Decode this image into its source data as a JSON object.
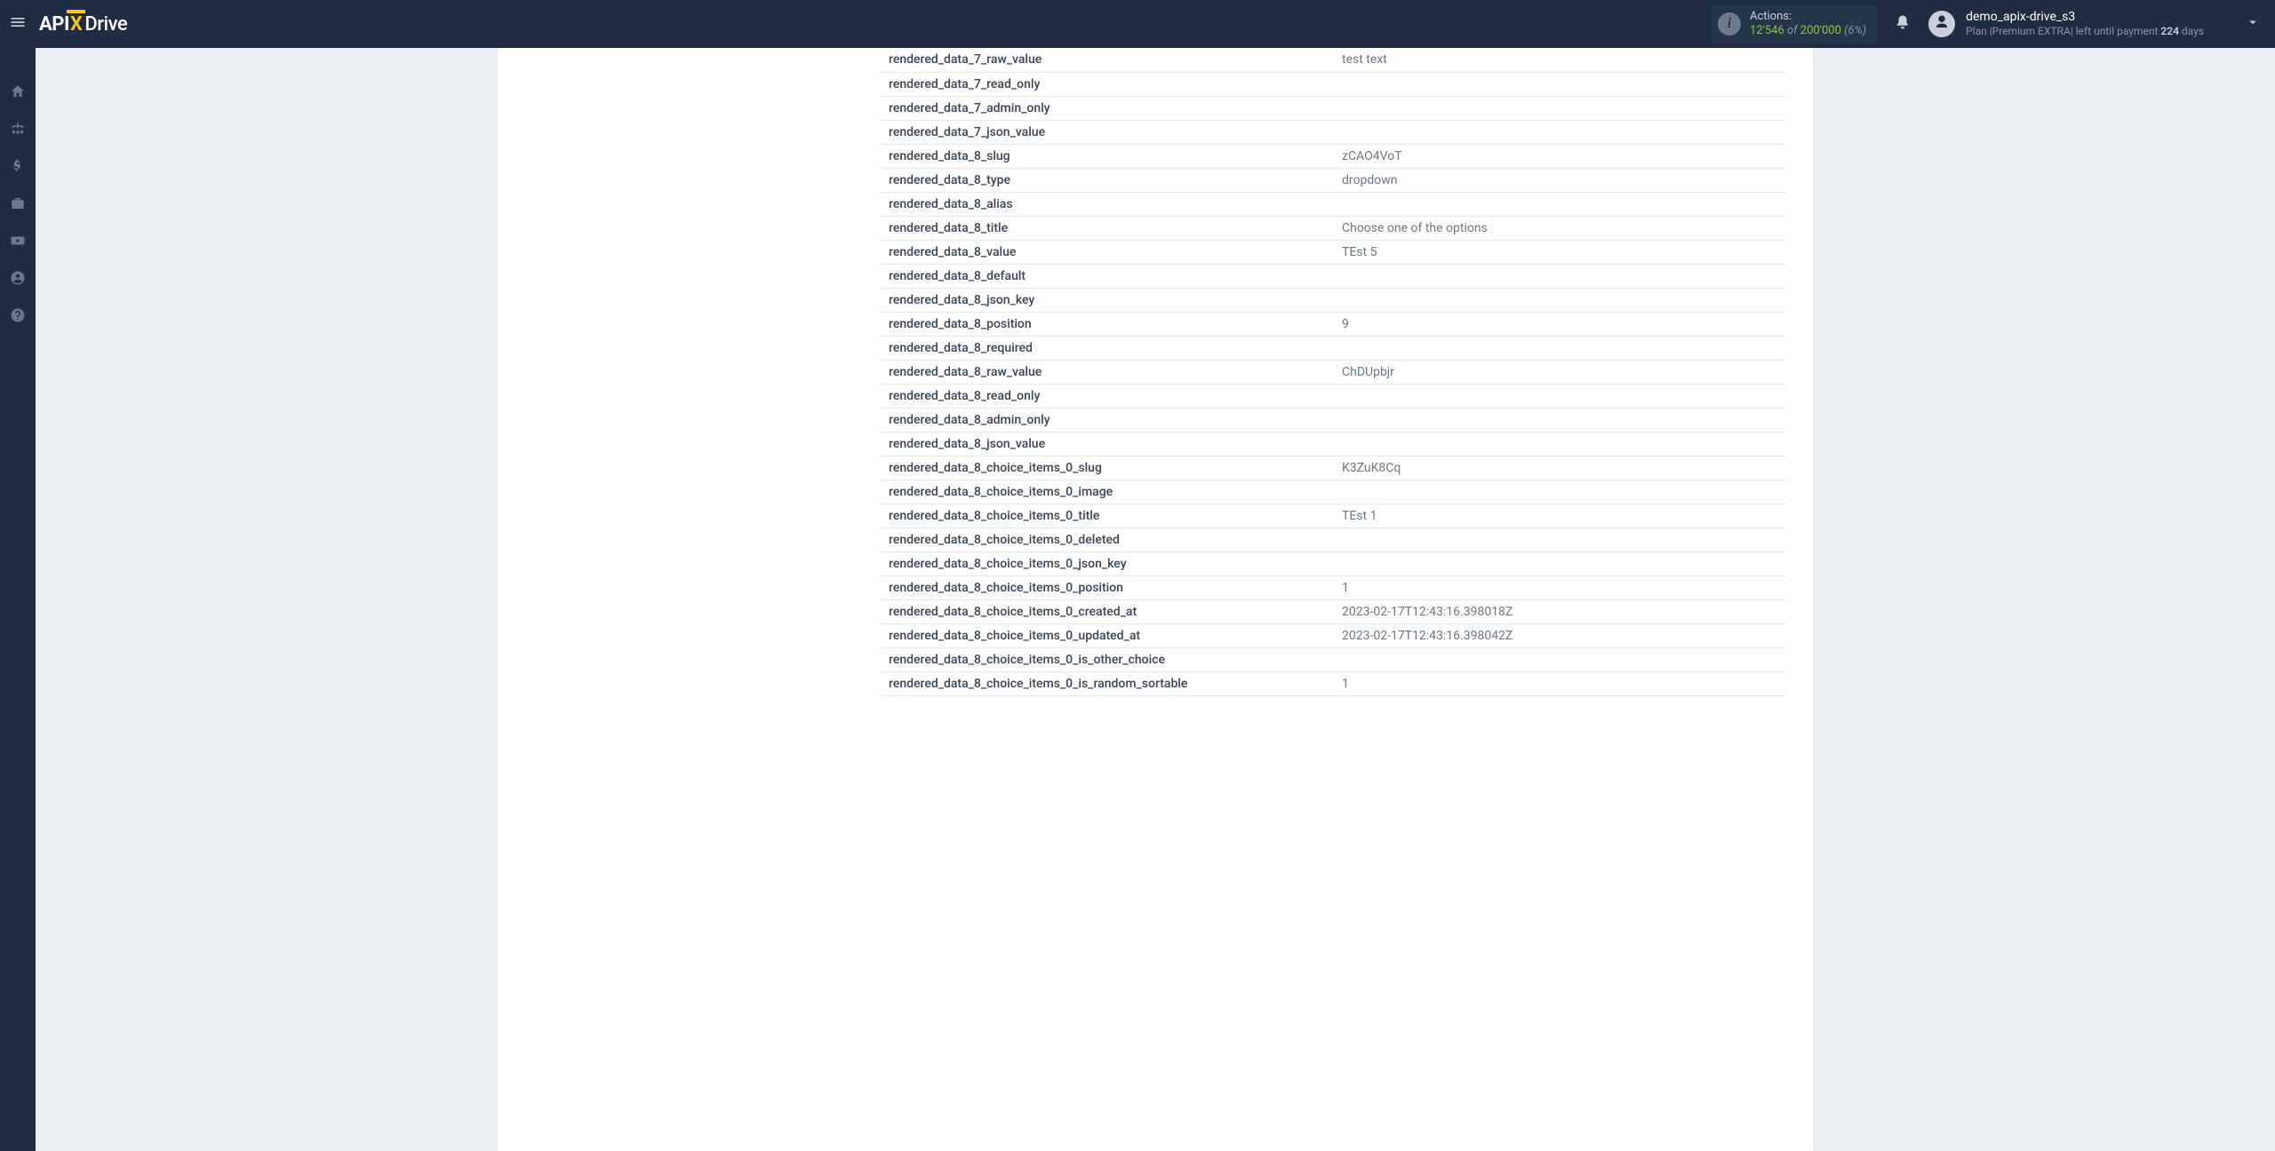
{
  "header": {
    "logo": {
      "api": "API",
      "x": "X",
      "drive": "Drive"
    },
    "actions": {
      "label": "Actions:",
      "current": "12'546",
      "of": " of ",
      "max": "200'000",
      "pct": " (6%)"
    },
    "user": {
      "name": "demo_apix-drive_s3",
      "plan_prefix": "Plan |",
      "plan_name": "Premium EXTRA",
      "plan_mid": "| left until payment ",
      "days": "224",
      "days_suffix": " days"
    }
  },
  "rows": [
    {
      "key": "rendered_data_7_raw_value",
      "val": "test text"
    },
    {
      "key": "rendered_data_7_read_only",
      "val": ""
    },
    {
      "key": "rendered_data_7_admin_only",
      "val": ""
    },
    {
      "key": "rendered_data_7_json_value",
      "val": ""
    },
    {
      "key": "rendered_data_8_slug",
      "val": "zCAO4VoT"
    },
    {
      "key": "rendered_data_8_type",
      "val": "dropdown"
    },
    {
      "key": "rendered_data_8_alias",
      "val": ""
    },
    {
      "key": "rendered_data_8_title",
      "val": "Choose one of the options"
    },
    {
      "key": "rendered_data_8_value",
      "val": "TEst 5"
    },
    {
      "key": "rendered_data_8_default",
      "val": ""
    },
    {
      "key": "rendered_data_8_json_key",
      "val": ""
    },
    {
      "key": "rendered_data_8_position",
      "val": "9"
    },
    {
      "key": "rendered_data_8_required",
      "val": ""
    },
    {
      "key": "rendered_data_8_raw_value",
      "val": "ChDUpbjr"
    },
    {
      "key": "rendered_data_8_read_only",
      "val": ""
    },
    {
      "key": "rendered_data_8_admin_only",
      "val": ""
    },
    {
      "key": "rendered_data_8_json_value",
      "val": ""
    },
    {
      "key": "rendered_data_8_choice_items_0_slug",
      "val": "K3ZuK8Cq"
    },
    {
      "key": "rendered_data_8_choice_items_0_image",
      "val": ""
    },
    {
      "key": "rendered_data_8_choice_items_0_title",
      "val": "TEst 1"
    },
    {
      "key": "rendered_data_8_choice_items_0_deleted",
      "val": ""
    },
    {
      "key": "rendered_data_8_choice_items_0_json_key",
      "val": ""
    },
    {
      "key": "rendered_data_8_choice_items_0_position",
      "val": "1"
    },
    {
      "key": "rendered_data_8_choice_items_0_created_at",
      "val": "2023-02-17T12:43:16.398018Z"
    },
    {
      "key": "rendered_data_8_choice_items_0_updated_at",
      "val": "2023-02-17T12:43:16.398042Z"
    },
    {
      "key": "rendered_data_8_choice_items_0_is_other_choice",
      "val": ""
    },
    {
      "key": "rendered_data_8_choice_items_0_is_random_sortable",
      "val": "1"
    }
  ]
}
